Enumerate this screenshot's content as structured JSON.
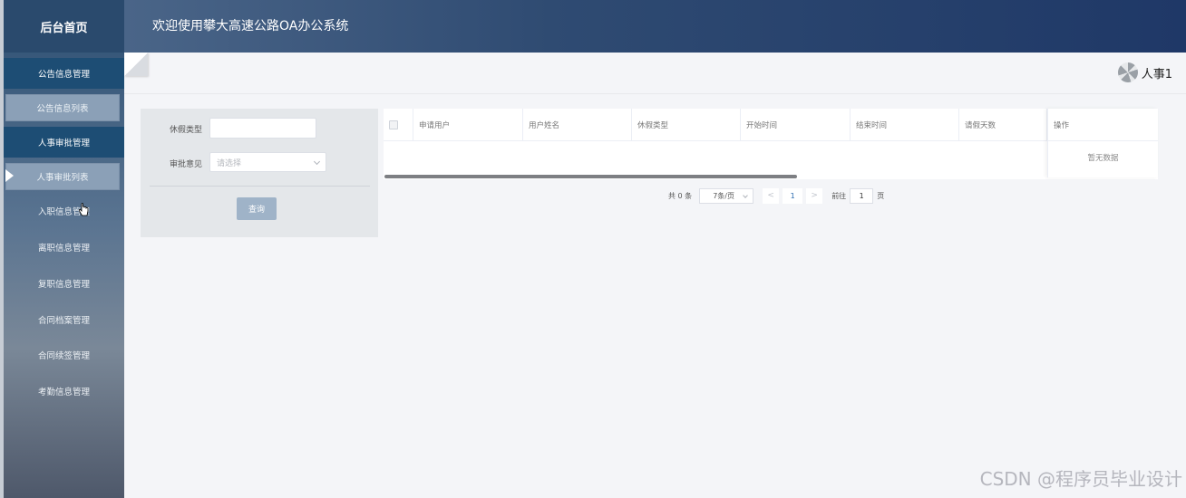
{
  "sidebar": {
    "brand": "后台首页",
    "items": [
      {
        "label": "公告信息管理",
        "kind": "group"
      },
      {
        "label": "公告信息列表",
        "kind": "sub"
      },
      {
        "label": "人事审批管理",
        "kind": "group"
      },
      {
        "label": "人事审批列表",
        "kind": "sub",
        "active": true
      },
      {
        "label": "入职信息管理",
        "kind": "plain"
      },
      {
        "label": "离职信息管理",
        "kind": "plain"
      },
      {
        "label": "复职信息管理",
        "kind": "plain"
      },
      {
        "label": "合同档案管理",
        "kind": "plain"
      },
      {
        "label": "合同续签管理",
        "kind": "plain"
      },
      {
        "label": "考勤信息管理",
        "kind": "plain"
      }
    ]
  },
  "header": {
    "title": "欢迎使用攀大高速公路OA办公系统"
  },
  "topbar": {
    "user_name": "人事1"
  },
  "search": {
    "leave_type_label": "休假类型",
    "leave_type_value": "",
    "approval_label": "审批意见",
    "approval_placeholder": "请选择",
    "query_label": "查询"
  },
  "table": {
    "columns": [
      "申请用户",
      "用户姓名",
      "休假类型",
      "开始时间",
      "结束时间",
      "请假天数"
    ],
    "op_column": "操作",
    "empty_text": "暂无数据",
    "rows": []
  },
  "pager": {
    "total": "共 0 条",
    "page_size": "7条/页",
    "prev": "<",
    "current": "1",
    "next": ">",
    "goto_label": "前往",
    "goto_value": "1",
    "page_suffix": "页"
  },
  "watermark": "CSDN @程序员毕业设计",
  "colors": {
    "sidebar_group": "#1d4d74",
    "header_dark": "#1f3867",
    "query_button": "#9fb3c8",
    "page_active": "#2b6cb0"
  }
}
